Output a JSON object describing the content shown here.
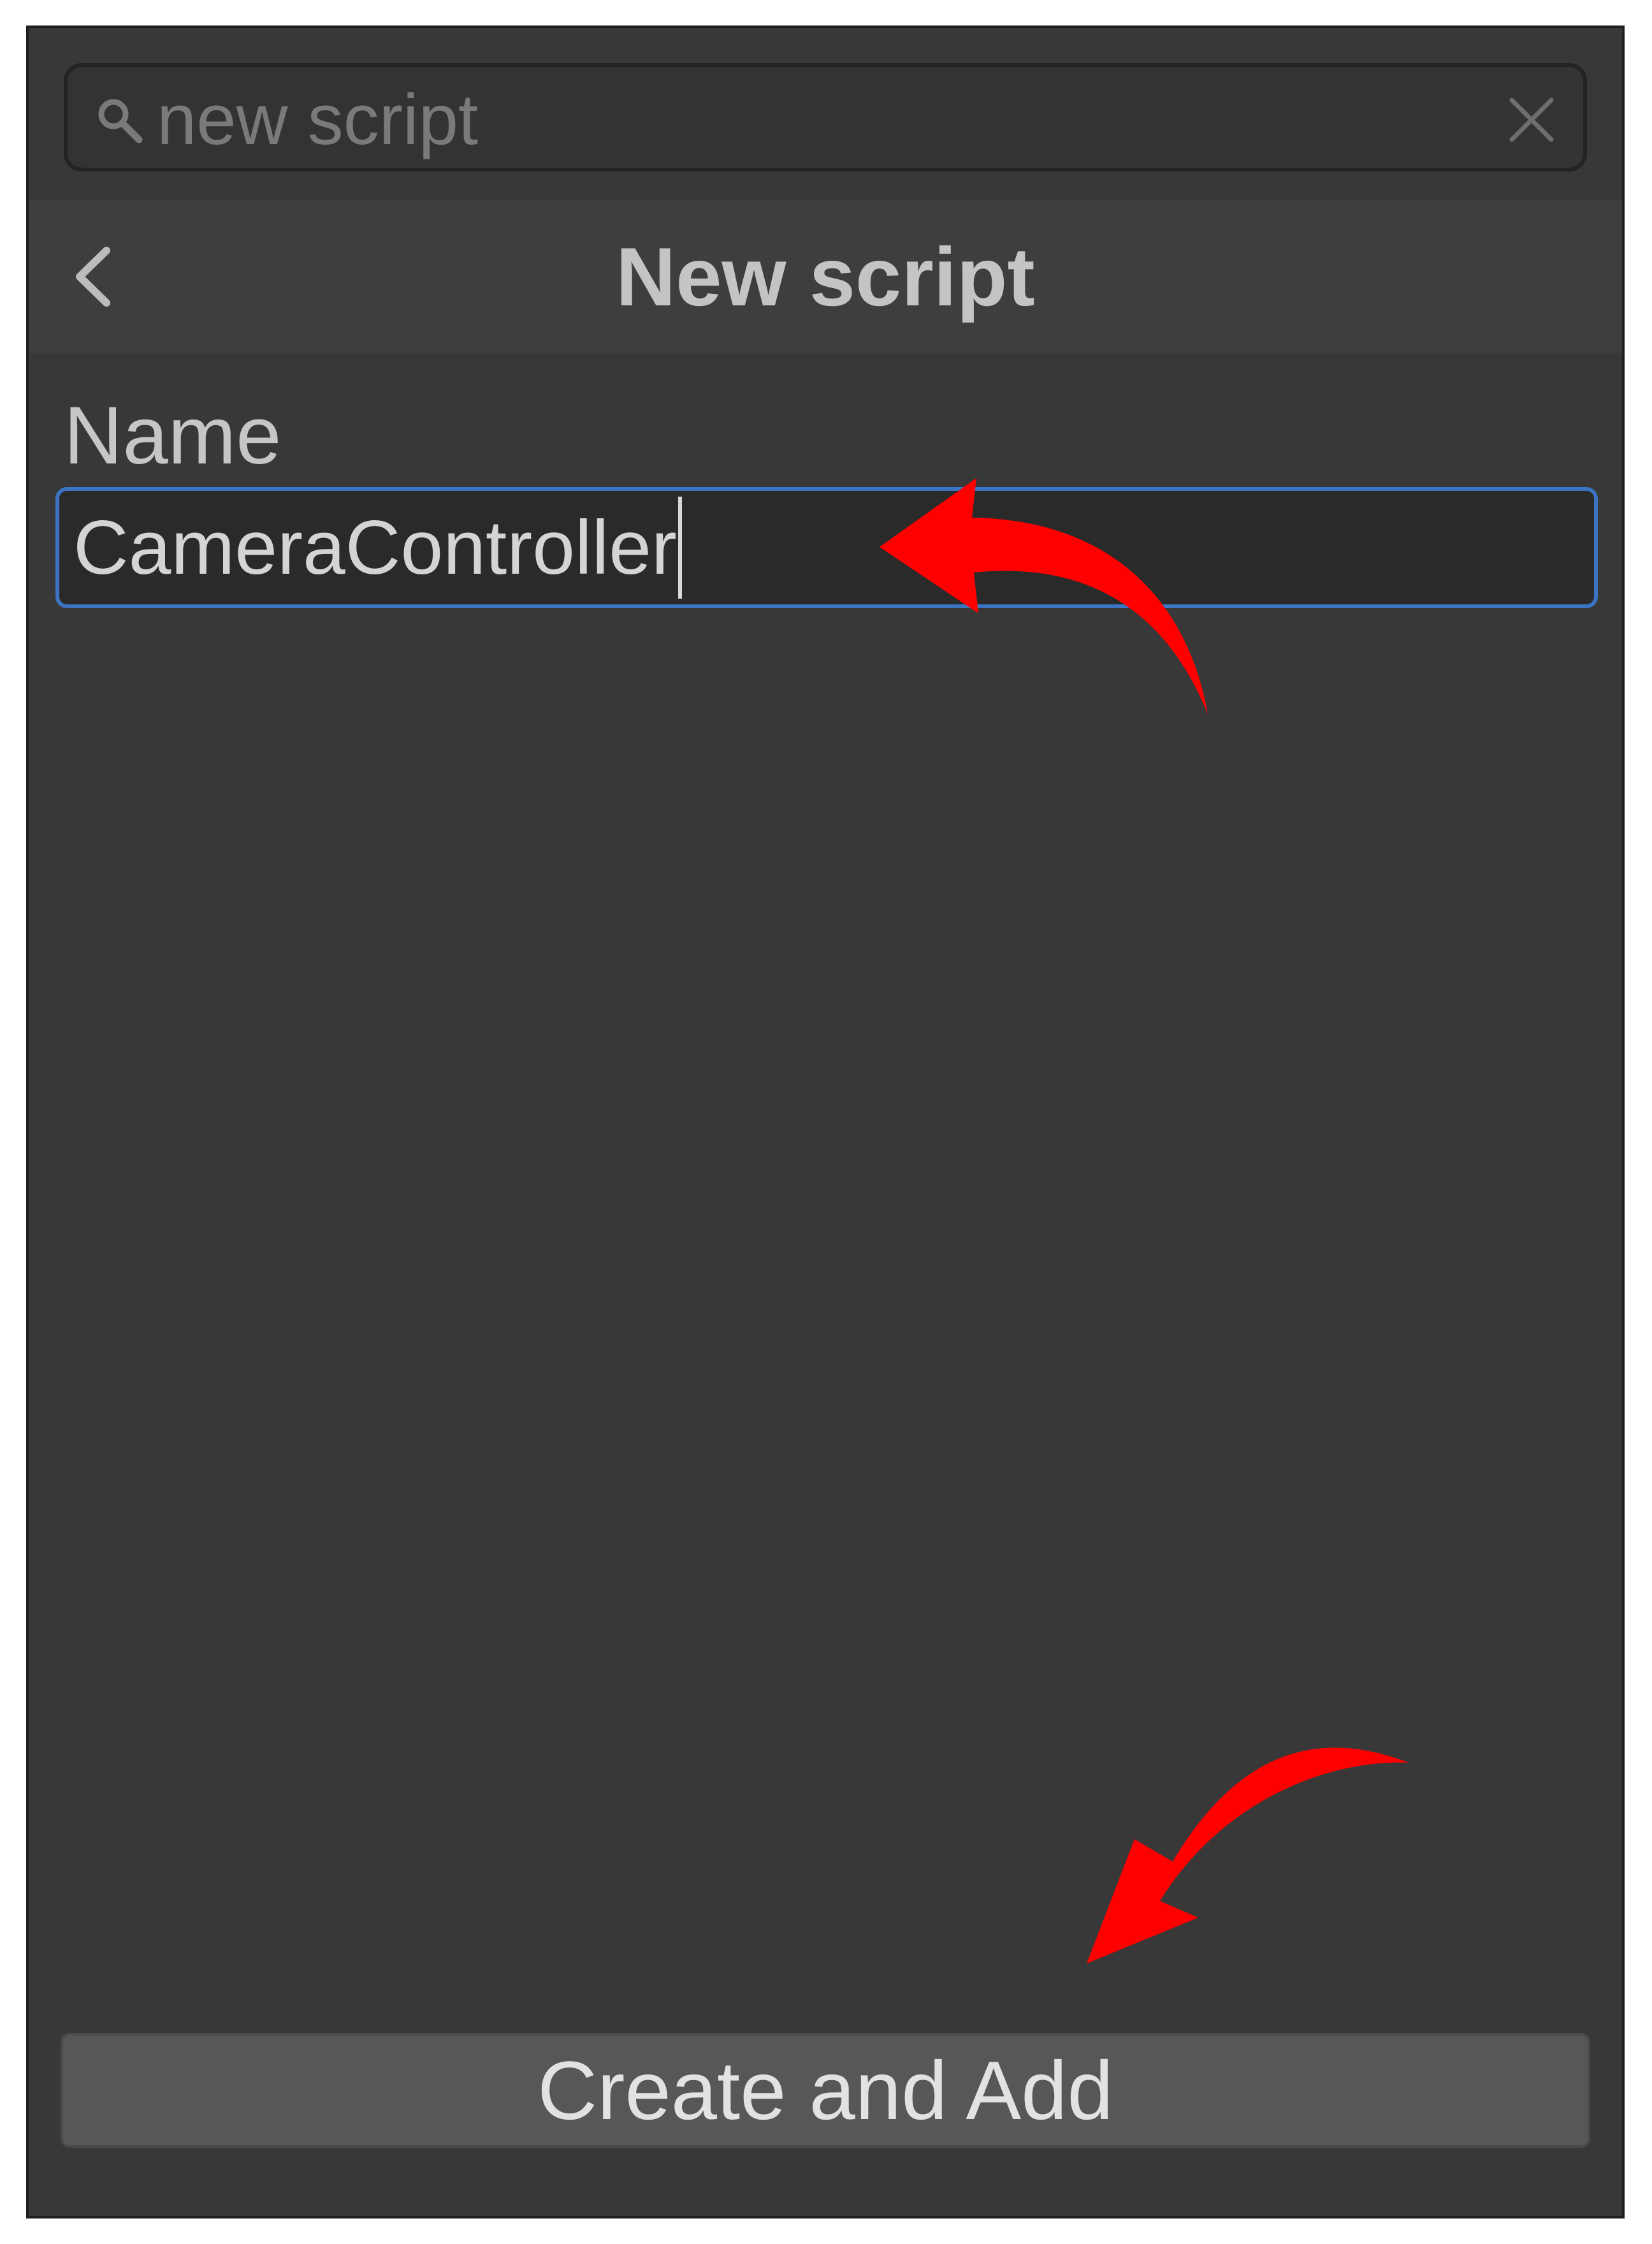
{
  "search": {
    "value": "new script",
    "icon": "search-icon",
    "clear_icon": "close-icon"
  },
  "header": {
    "title": "New script",
    "back_icon": "chevron-left-icon"
  },
  "form": {
    "name_label": "Name",
    "name_value": "CameraController"
  },
  "actions": {
    "create_label": "Create and Add"
  },
  "annotations": {
    "arrow_color": "#ff0000",
    "arrows": [
      "points-to-name-field",
      "points-to-create-button"
    ]
  },
  "colors": {
    "panel_bg": "#383838",
    "header_bg": "#3e3e3e",
    "field_border_focus": "#3b74c2",
    "button_bg": "#575757"
  }
}
